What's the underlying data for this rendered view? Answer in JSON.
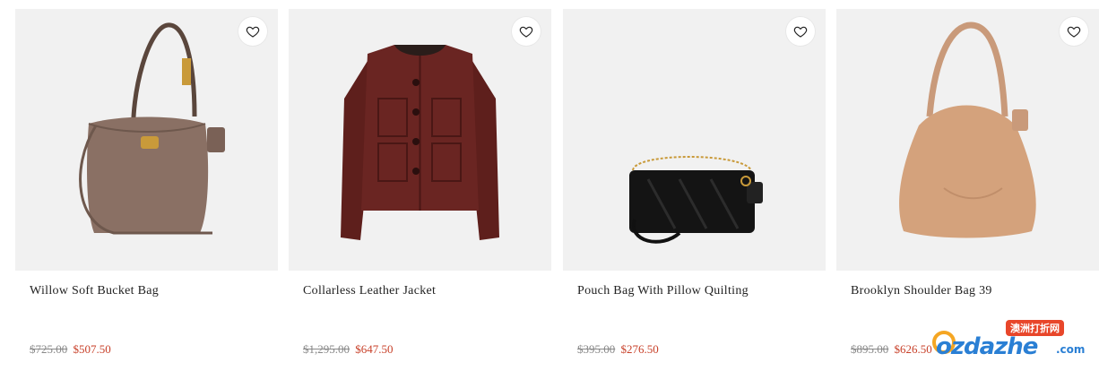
{
  "products": [
    {
      "name": "Willow Soft Bucket Bag",
      "old_price": "$725.00",
      "sale_price": "$507.50",
      "image_icon": "bucket-bag-image",
      "color": "#8a7064"
    },
    {
      "name": "Collarless Leather Jacket",
      "old_price": "$1,295.00",
      "sale_price": "$647.50",
      "image_icon": "leather-jacket-image",
      "color": "#5e1f1c"
    },
    {
      "name": "Pouch Bag With Pillow Quilting",
      "old_price": "$395.00",
      "sale_price": "$276.50",
      "image_icon": "quilted-pouch-image",
      "color": "#111111"
    },
    {
      "name": "Brooklyn Shoulder Bag 39",
      "old_price": "$895.00",
      "sale_price": "$626.50",
      "image_icon": "shoulder-bag-image",
      "color": "#d4a27c"
    }
  ],
  "watermark": {
    "badge": "澳洲打折网",
    "logo": "ozdazhe",
    "domain": ".com"
  },
  "colors": {
    "sale": "#c8412a",
    "card_bg": "#f1f1f1"
  }
}
